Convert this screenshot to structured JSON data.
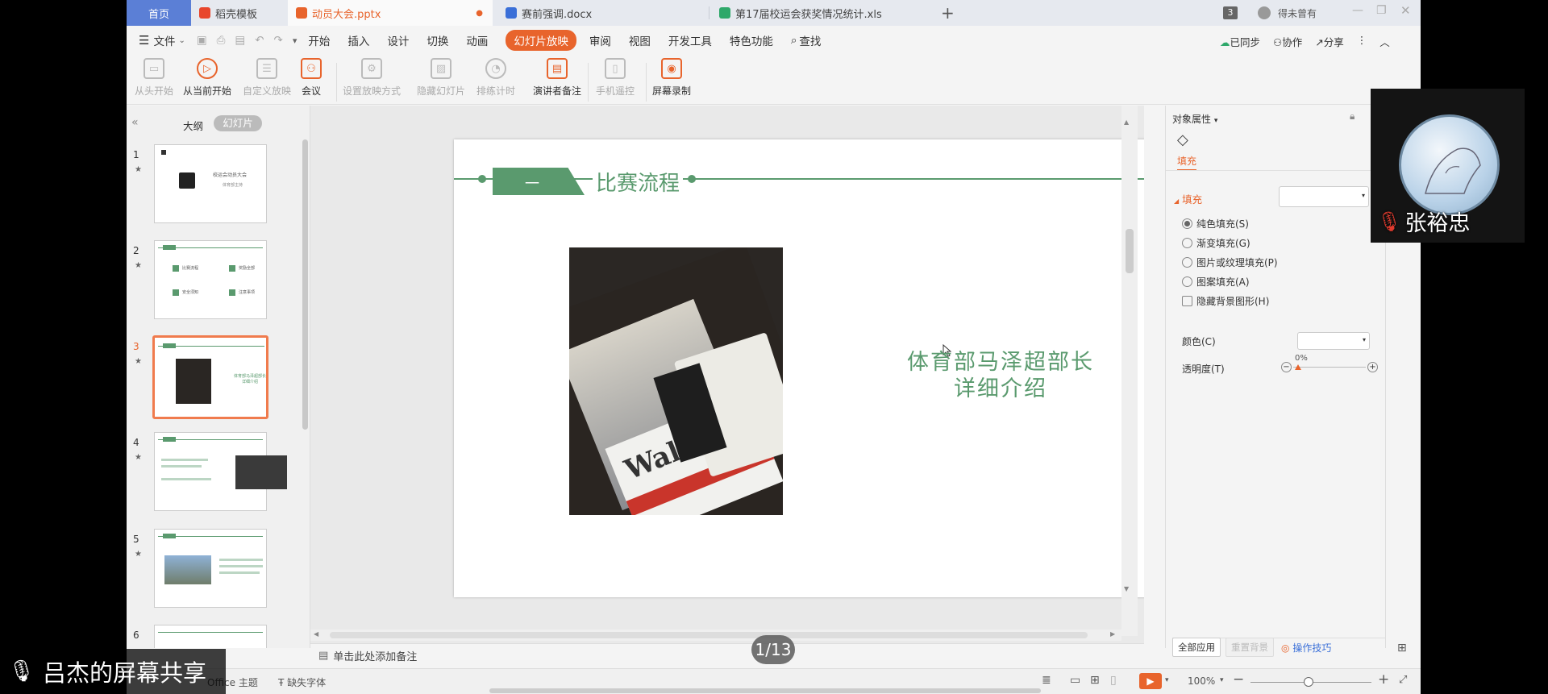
{
  "tabs": {
    "home": "首页",
    "template": "稻壳模板",
    "pptx": "动员大会.pptx",
    "docx": "赛前强调.docx",
    "xls": "第17届校运会获奖情况统计.xls",
    "badge": "3",
    "user": "得未曾有"
  },
  "menu": {
    "file": "文件",
    "items": [
      "开始",
      "插入",
      "设计",
      "切换",
      "动画"
    ],
    "slideshow": "幻灯片放映",
    "items2": [
      "审阅",
      "视图",
      "开发工具",
      "特色功能"
    ],
    "search": "查找",
    "sync": "已同步",
    "collab": "协作",
    "share": "分享"
  },
  "ribbon": {
    "from_start": "从头开始",
    "from_current": "从当前开始",
    "custom": "自定义放映",
    "meeting": "会议",
    "setup": "设置放映方式",
    "hide": "隐藏幻灯片",
    "rehearse": "排练计时",
    "notes": "演讲者备注",
    "remote": "手机遥控",
    "record": "屏幕录制"
  },
  "leftpanel": {
    "outline": "大纲",
    "slides": "幻灯片",
    "thumb1_title": "校运会动员大会",
    "thumb1_sub": "体育部主持",
    "thumb2_items": [
      "比赛流程",
      "奖励全部",
      "安全须知",
      "注意事项"
    ],
    "thumb3_text": "体育部马泽超部长 详细介绍"
  },
  "slide": {
    "section_number": "一",
    "title": "比赛流程",
    "text_line1": "体育部马泽超部长",
    "text_line2": "详细介绍",
    "book_text": "Wall Street"
  },
  "notes_placeholder": "单击此处添加备注",
  "rightpanel": {
    "header": "对象属性",
    "fill_tab": "填充",
    "fill_section": "填充",
    "options": [
      "纯色填充(S)",
      "渐变填充(G)",
      "图片或纹理填充(P)",
      "图案填充(A)"
    ],
    "hide_bg": "隐藏背景图形(H)",
    "color_label": "颜色(C)",
    "transparency_label": "透明度(T)",
    "transparency_value": "0%",
    "apply_all": "全部应用",
    "reset_bg": "重置背景",
    "tips": "操作技巧"
  },
  "status": {
    "theme": "Office 主题",
    "missing_font": "缺失字体",
    "zoom": "100%"
  },
  "overlay": {
    "share_text": "吕杰的屏幕共享",
    "participant": "张裕忠",
    "page": "1/13"
  },
  "colors": {
    "accent_orange": "#e8642c",
    "slide_green": "#5a9a6e",
    "tab_blue": "#5b7fd6"
  }
}
